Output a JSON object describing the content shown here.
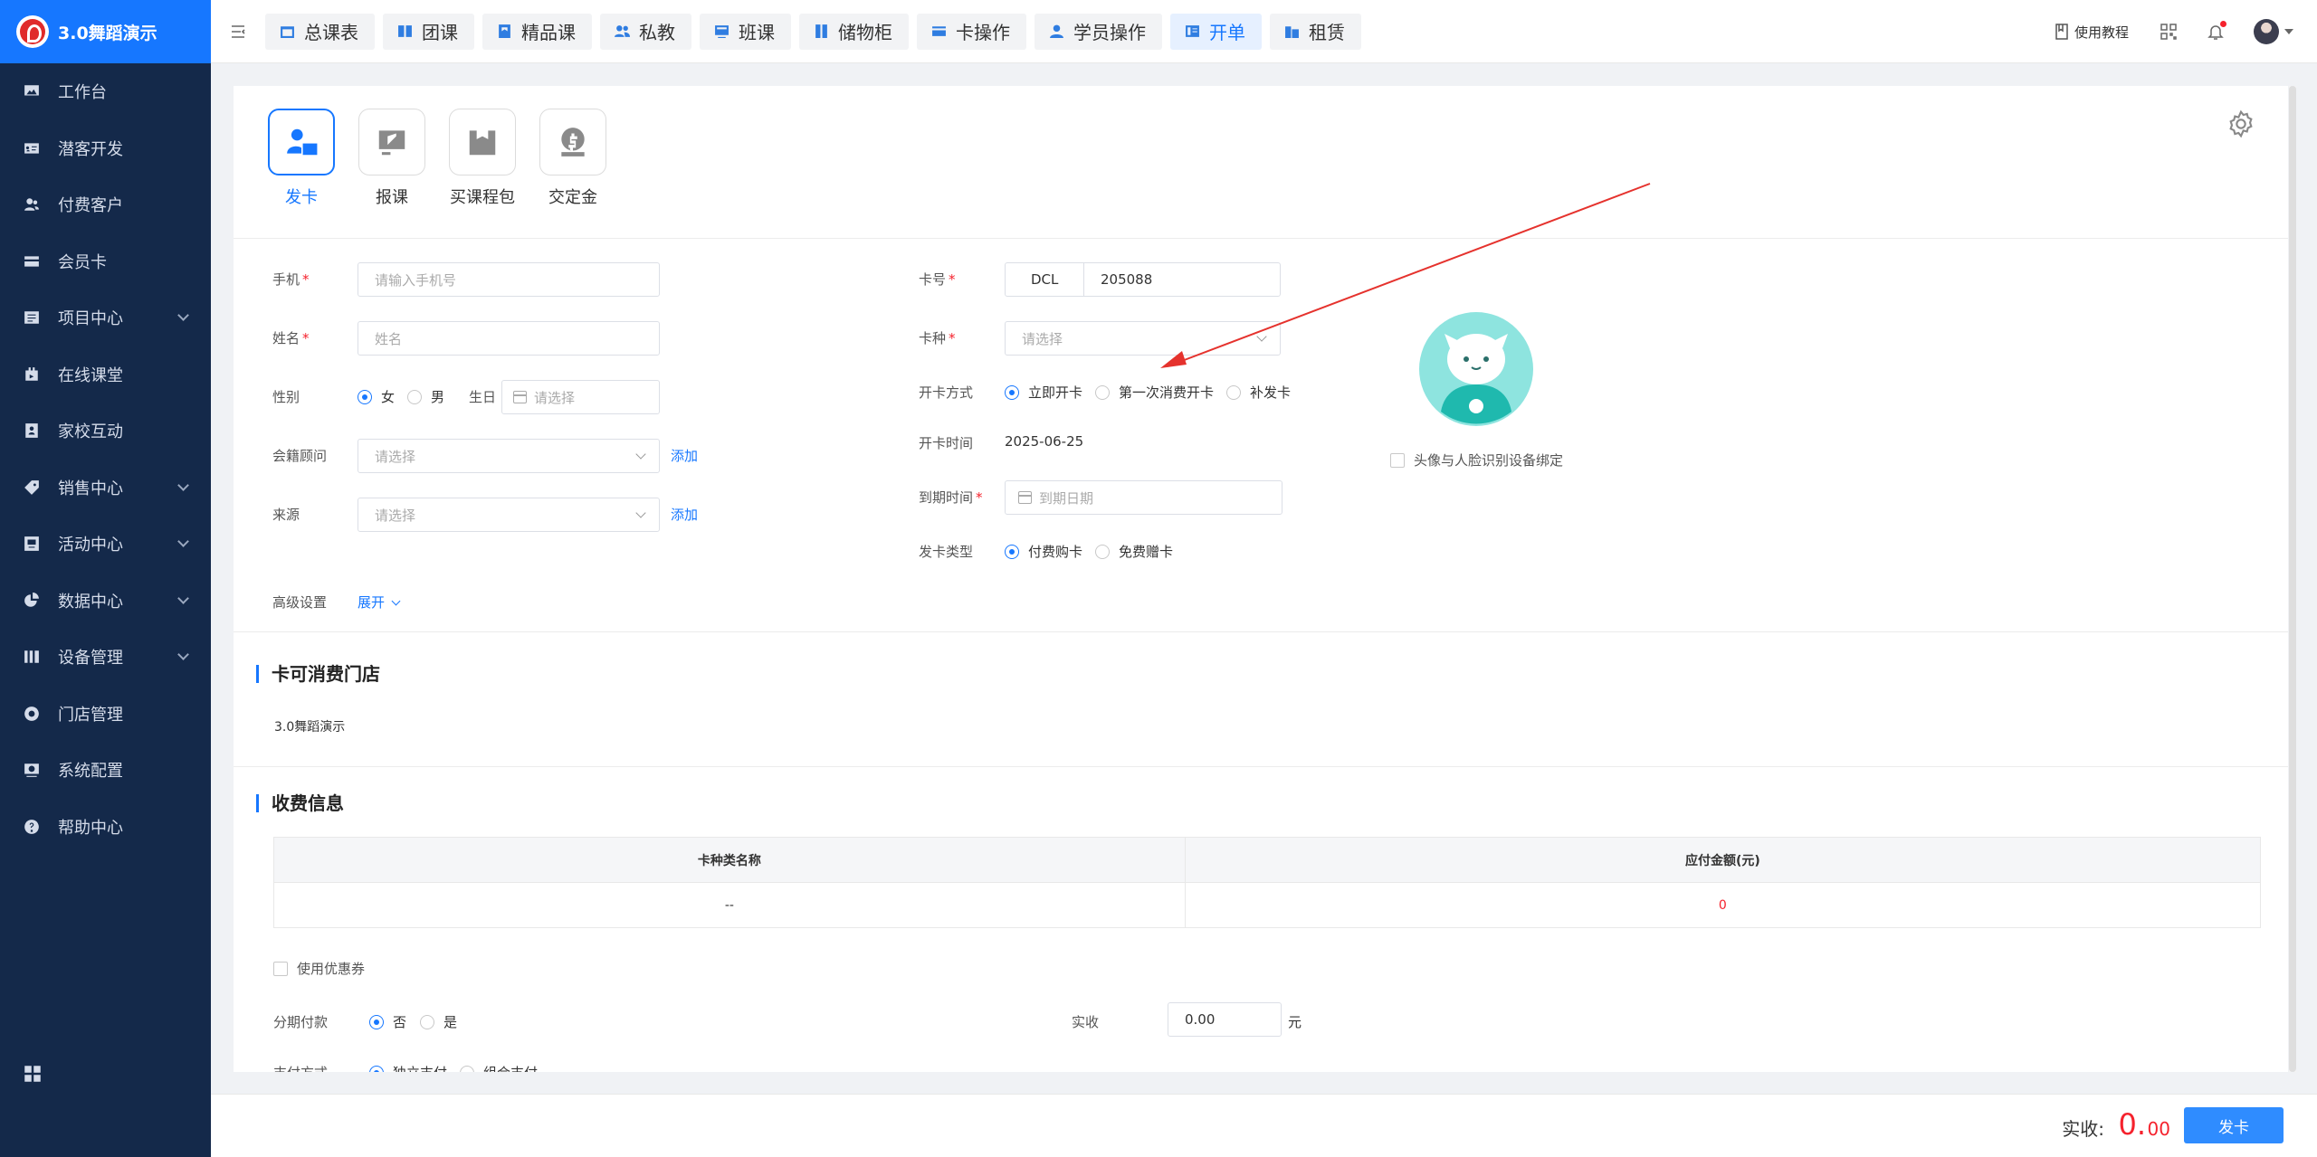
{
  "app": {
    "brand": "3.0舞蹈演示"
  },
  "sidebar": {
    "items": [
      {
        "label": "工作台",
        "icon": "monitor-icon",
        "expandable": false
      },
      {
        "label": "潜客开发",
        "icon": "id-card-icon",
        "expandable": false
      },
      {
        "label": "付费客户",
        "icon": "users-icon",
        "expandable": false
      },
      {
        "label": "会员卡",
        "icon": "card-icon",
        "expandable": false
      },
      {
        "label": "项目中心",
        "icon": "folder-icon",
        "expandable": true
      },
      {
        "label": "在线课堂",
        "icon": "classroom-icon",
        "expandable": false
      },
      {
        "label": "家校互动",
        "icon": "contact-icon",
        "expandable": false
      },
      {
        "label": "销售中心",
        "icon": "tag-icon",
        "expandable": true
      },
      {
        "label": "活动中心",
        "icon": "activity-icon",
        "expandable": true
      },
      {
        "label": "数据中心",
        "icon": "pie-chart-icon",
        "expandable": true
      },
      {
        "label": "设备管理",
        "icon": "device-icon",
        "expandable": true
      },
      {
        "label": "门店管理",
        "icon": "store-icon",
        "expandable": false
      },
      {
        "label": "系统配置",
        "icon": "settings-screen-icon",
        "expandable": false
      },
      {
        "label": "帮助中心",
        "icon": "help-icon",
        "expandable": false
      }
    ]
  },
  "topbar": {
    "tabs": [
      {
        "label": "总课表",
        "active": false
      },
      {
        "label": "团课",
        "active": false
      },
      {
        "label": "精品课",
        "active": false
      },
      {
        "label": "私教",
        "active": false
      },
      {
        "label": "班课",
        "active": false
      },
      {
        "label": "储物柜",
        "active": false
      },
      {
        "label": "卡操作",
        "active": false
      },
      {
        "label": "学员操作",
        "active": false
      },
      {
        "label": "开单",
        "active": true
      },
      {
        "label": "租赁",
        "active": false
      }
    ],
    "tutorial": "使用教程"
  },
  "ops": [
    {
      "label": "发卡",
      "active": true
    },
    {
      "label": "报课",
      "active": false
    },
    {
      "label": "买课程包",
      "active": false
    },
    {
      "label": "交定金",
      "active": false
    }
  ],
  "form": {
    "phone": {
      "label": "手机",
      "placeholder": "请输入手机号"
    },
    "name": {
      "label": "姓名",
      "placeholder": "姓名"
    },
    "gender": {
      "label": "性别",
      "female": "女",
      "male": "男",
      "selected": "女"
    },
    "birthday": {
      "label": "生日",
      "placeholder": "请选择"
    },
    "advisor": {
      "label": "会籍顾问",
      "placeholder": "请选择",
      "add": "添加"
    },
    "source": {
      "label": "来源",
      "placeholder": "请选择",
      "add": "添加"
    },
    "advanced": {
      "label": "高级设置",
      "toggle": "展开"
    },
    "card_no": {
      "label": "卡号",
      "prefix": "DCL",
      "value": "205088"
    },
    "card_type": {
      "label": "卡种",
      "placeholder": "请选择"
    },
    "open_method": {
      "label": "开卡方式",
      "options": [
        "立即开卡",
        "第一次消费开卡",
        "补发卡"
      ],
      "selected": "立即开卡"
    },
    "open_time": {
      "label": "开卡时间",
      "value": "2025-06-25"
    },
    "expire_time": {
      "label": "到期时间",
      "placeholder": "到期日期"
    },
    "issue_type": {
      "label": "发卡类型",
      "options": [
        "付费购卡",
        "免费赠卡"
      ],
      "selected": "付费购卡"
    },
    "face_bind": "头像与人脸识别设备绑定"
  },
  "stores": {
    "title": "卡可消费门店",
    "value": "3.0舞蹈演示"
  },
  "fees": {
    "title": "收费信息",
    "columns": [
      "卡种类名称",
      "应付金额(元)"
    ],
    "rows": [
      [
        "--",
        "0"
      ]
    ],
    "coupon": "使用优惠券",
    "installment": {
      "label": "分期付款",
      "no": "否",
      "yes": "是",
      "selected": "否"
    },
    "paid": {
      "label": "实收",
      "value": "0.00",
      "unit": "元"
    },
    "pay_method_partial": {
      "label": "支付方式",
      "options": [
        "独立支付",
        "组合支付"
      ]
    }
  },
  "footer": {
    "label": "实收:",
    "amount_int": "0.",
    "amount_dec": "00",
    "submit": "发卡"
  },
  "colors": {
    "primary": "#1677ff",
    "sidebar": "#14294a",
    "danger": "#f5222d"
  }
}
